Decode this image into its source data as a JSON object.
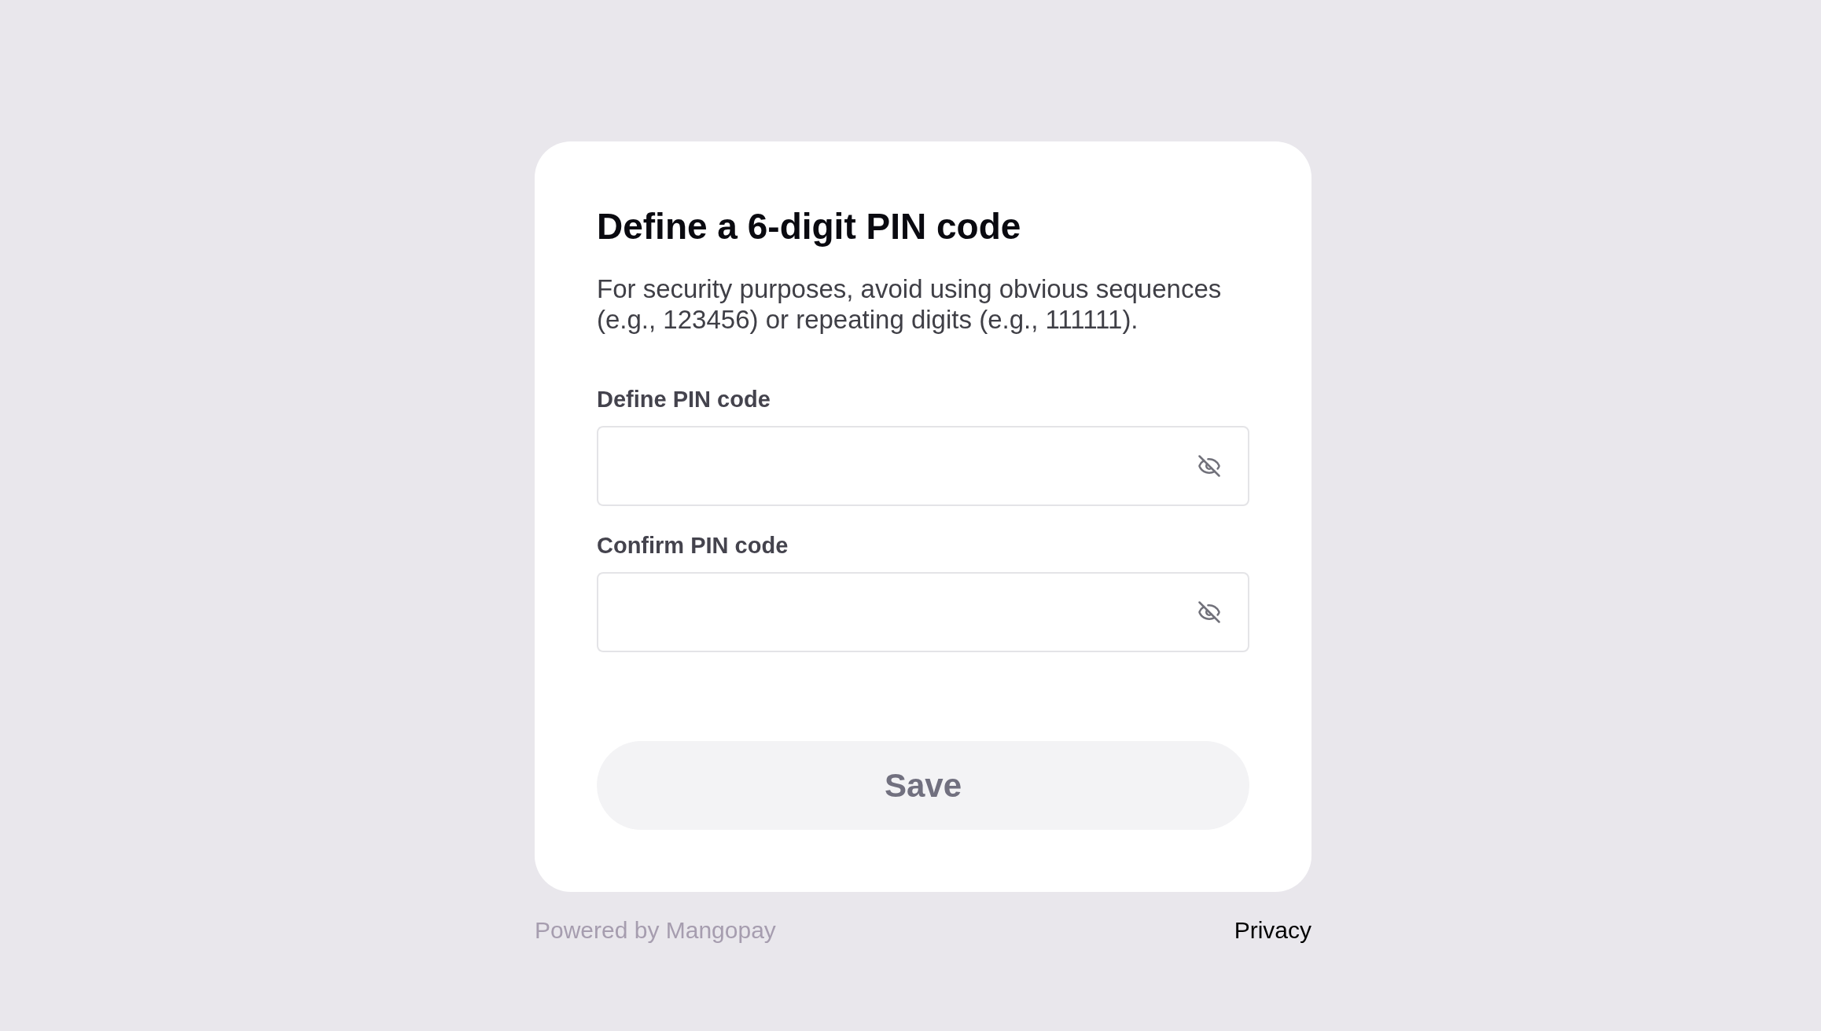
{
  "title": "Define a 6-digit PIN code",
  "description": "For security purposes, avoid using obvious sequences (e.g., 123456) or repeating digits (e.g., 111111).",
  "fields": [
    {
      "label": "Define PIN code",
      "masked": true
    },
    {
      "label": "Confirm PIN code",
      "masked": true
    }
  ],
  "save_button": {
    "label": "Save",
    "disabled": true
  },
  "footer": {
    "powered_by": "Powered by Mangopay",
    "privacy_link": "Privacy"
  }
}
